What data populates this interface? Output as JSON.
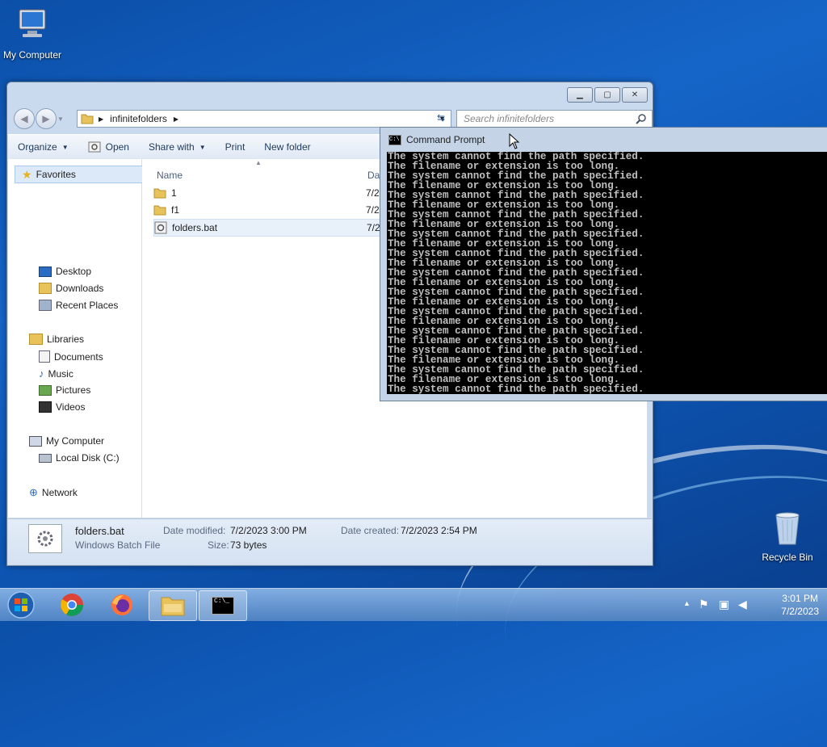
{
  "desktop": {
    "my_computer_label": "My Computer",
    "recycle_bin_label": "Recycle Bin"
  },
  "explorer": {
    "address_segment": "infinitefolders",
    "search_placeholder": "Search infinitefolders",
    "toolbar": {
      "organize": "Organize",
      "open": "Open",
      "share_with": "Share with",
      "print": "Print",
      "new_folder": "New folder"
    },
    "nav": {
      "favorites": "Favorites",
      "desktop": "Desktop",
      "downloads": "Downloads",
      "recent_places": "Recent Places",
      "libraries": "Libraries",
      "documents": "Documents",
      "music": "Music",
      "pictures": "Pictures",
      "videos": "Videos",
      "my_computer": "My Computer",
      "local_disk": "Local Disk (C:)",
      "network": "Network"
    },
    "columns": {
      "name": "Name",
      "date": "Dat"
    },
    "files": [
      {
        "name": "1",
        "date": "7/2",
        "icon": "folder-icon"
      },
      {
        "name": "f1",
        "date": "7/2",
        "icon": "folder-icon"
      },
      {
        "name": "folders.bat",
        "date": "7/2",
        "icon": "batch-file-icon"
      }
    ],
    "details": {
      "filename": "folders.bat",
      "filetype": "Windows Batch File",
      "date_modified_label": "Date modified:",
      "date_modified": "7/2/2023 3:00 PM",
      "size_label": "Size:",
      "size": "73 bytes",
      "date_created_label": "Date created:",
      "date_created": "7/2/2023 2:54 PM"
    }
  },
  "cmd": {
    "title": "Command Prompt",
    "lines": [
      "The system cannot find the path specified.",
      "The filename or extension is too long.",
      "The system cannot find the path specified.",
      "The filename or extension is too long.",
      "The system cannot find the path specified.",
      "The filename or extension is too long.",
      "The system cannot find the path specified.",
      "The filename or extension is too long.",
      "The system cannot find the path specified.",
      "The filename or extension is too long.",
      "The system cannot find the path specified.",
      "The filename or extension is too long.",
      "The system cannot find the path specified.",
      "The filename or extension is too long.",
      "The system cannot find the path specified.",
      "The filename or extension is too long.",
      "The system cannot find the path specified.",
      "The filename or extension is too long.",
      "The system cannot find the path specified.",
      "The filename or extension is too long.",
      "The system cannot find the path specified.",
      "The filename or extension is too long.",
      "The system cannot find the path specified.",
      "The filename or extension is too long.",
      "The system cannot find the path specified."
    ]
  },
  "taskbar": {
    "time": "3:01 PM",
    "date": "7/2/2023"
  },
  "colors": {
    "desktop_blue": "#0d56b4",
    "cmd_background": "#000000",
    "cmd_text": "#c0c0c0"
  }
}
